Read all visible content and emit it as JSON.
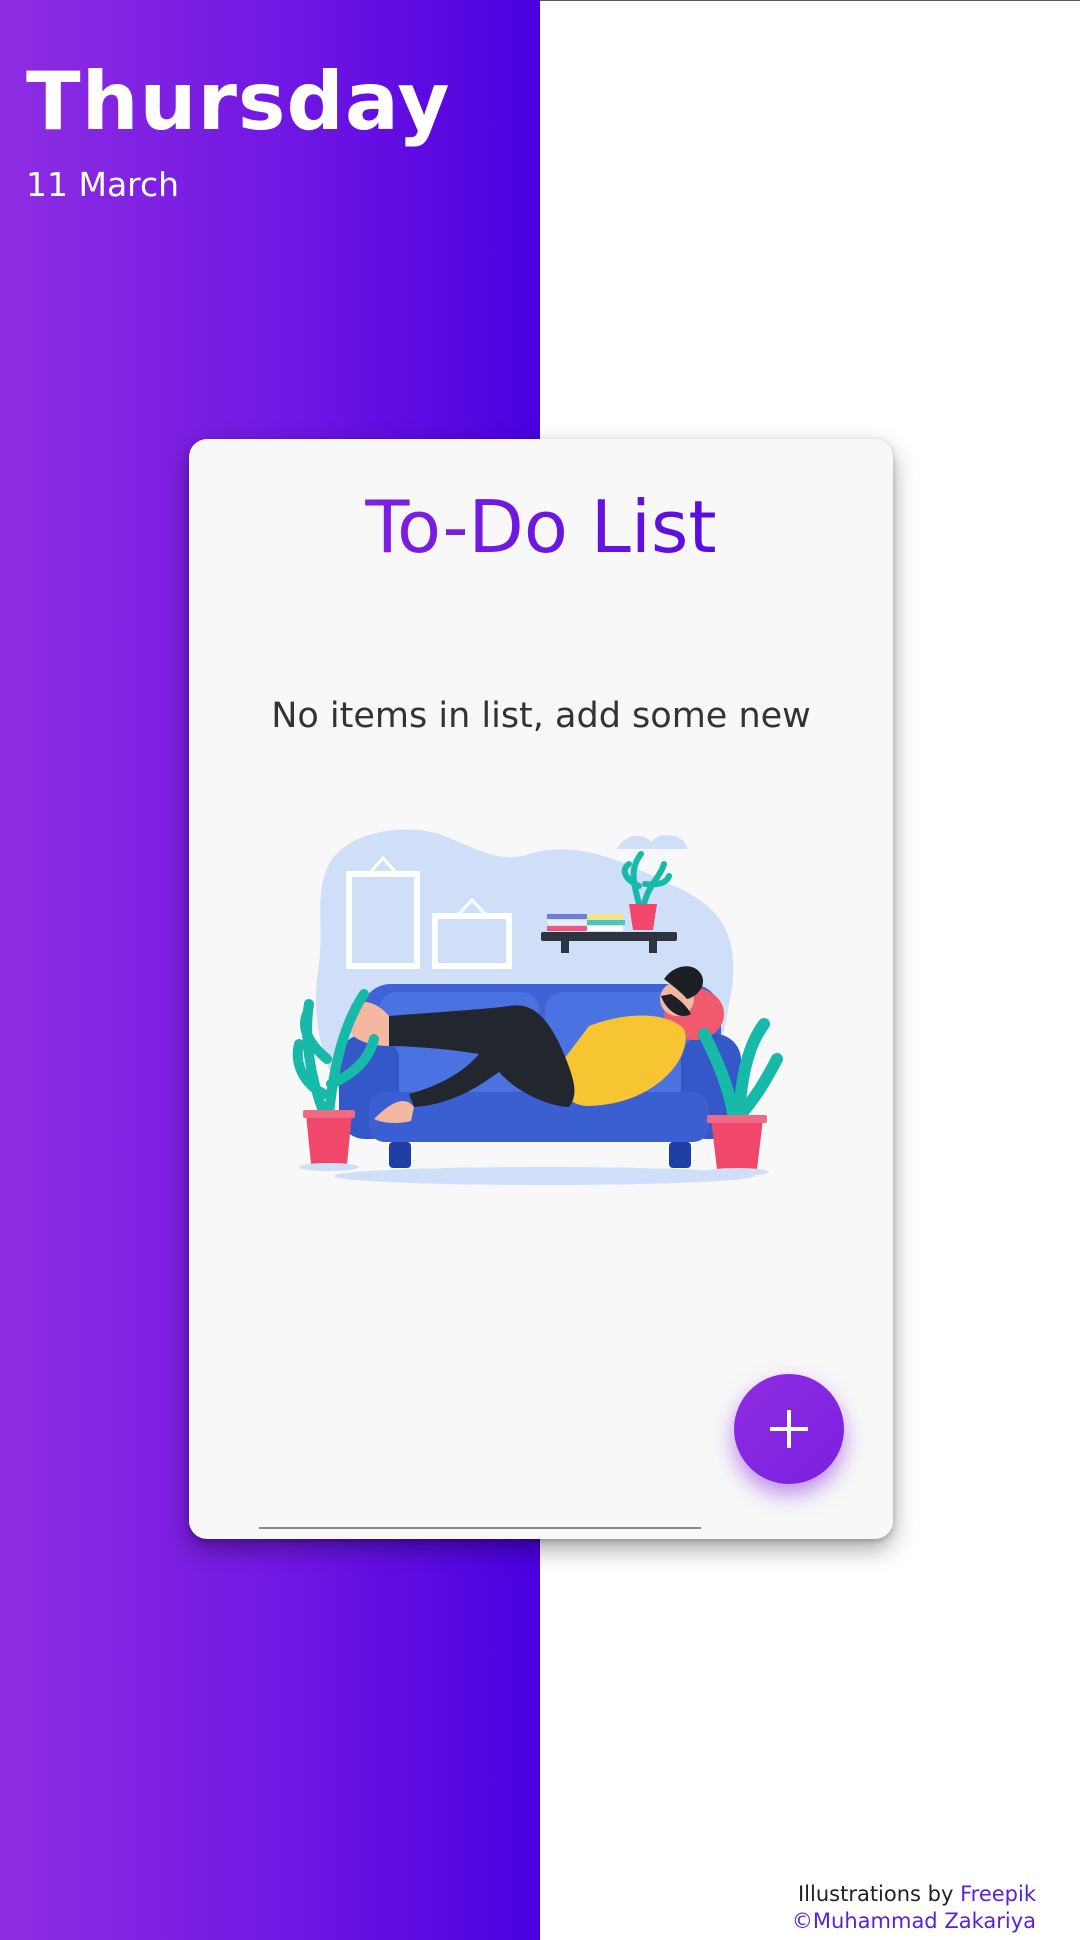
{
  "header": {
    "day": "Thursday",
    "date": "11 March"
  },
  "card": {
    "title": "To-Do List",
    "empty_message": "No items in list, add some new",
    "input_value": "",
    "add_button_icon": "plus-icon"
  },
  "credits": {
    "illustrations_prefix": "Illustrations by",
    "illustrations_author": "Freepik",
    "copyright_symbol": "©",
    "copyright_author": "Muhammad Zakariya"
  },
  "colors": {
    "gradient_start": "#8e2de2",
    "gradient_end": "#4a00e0",
    "card_background": "#f8f8f8",
    "accent": "#5b21d8"
  }
}
